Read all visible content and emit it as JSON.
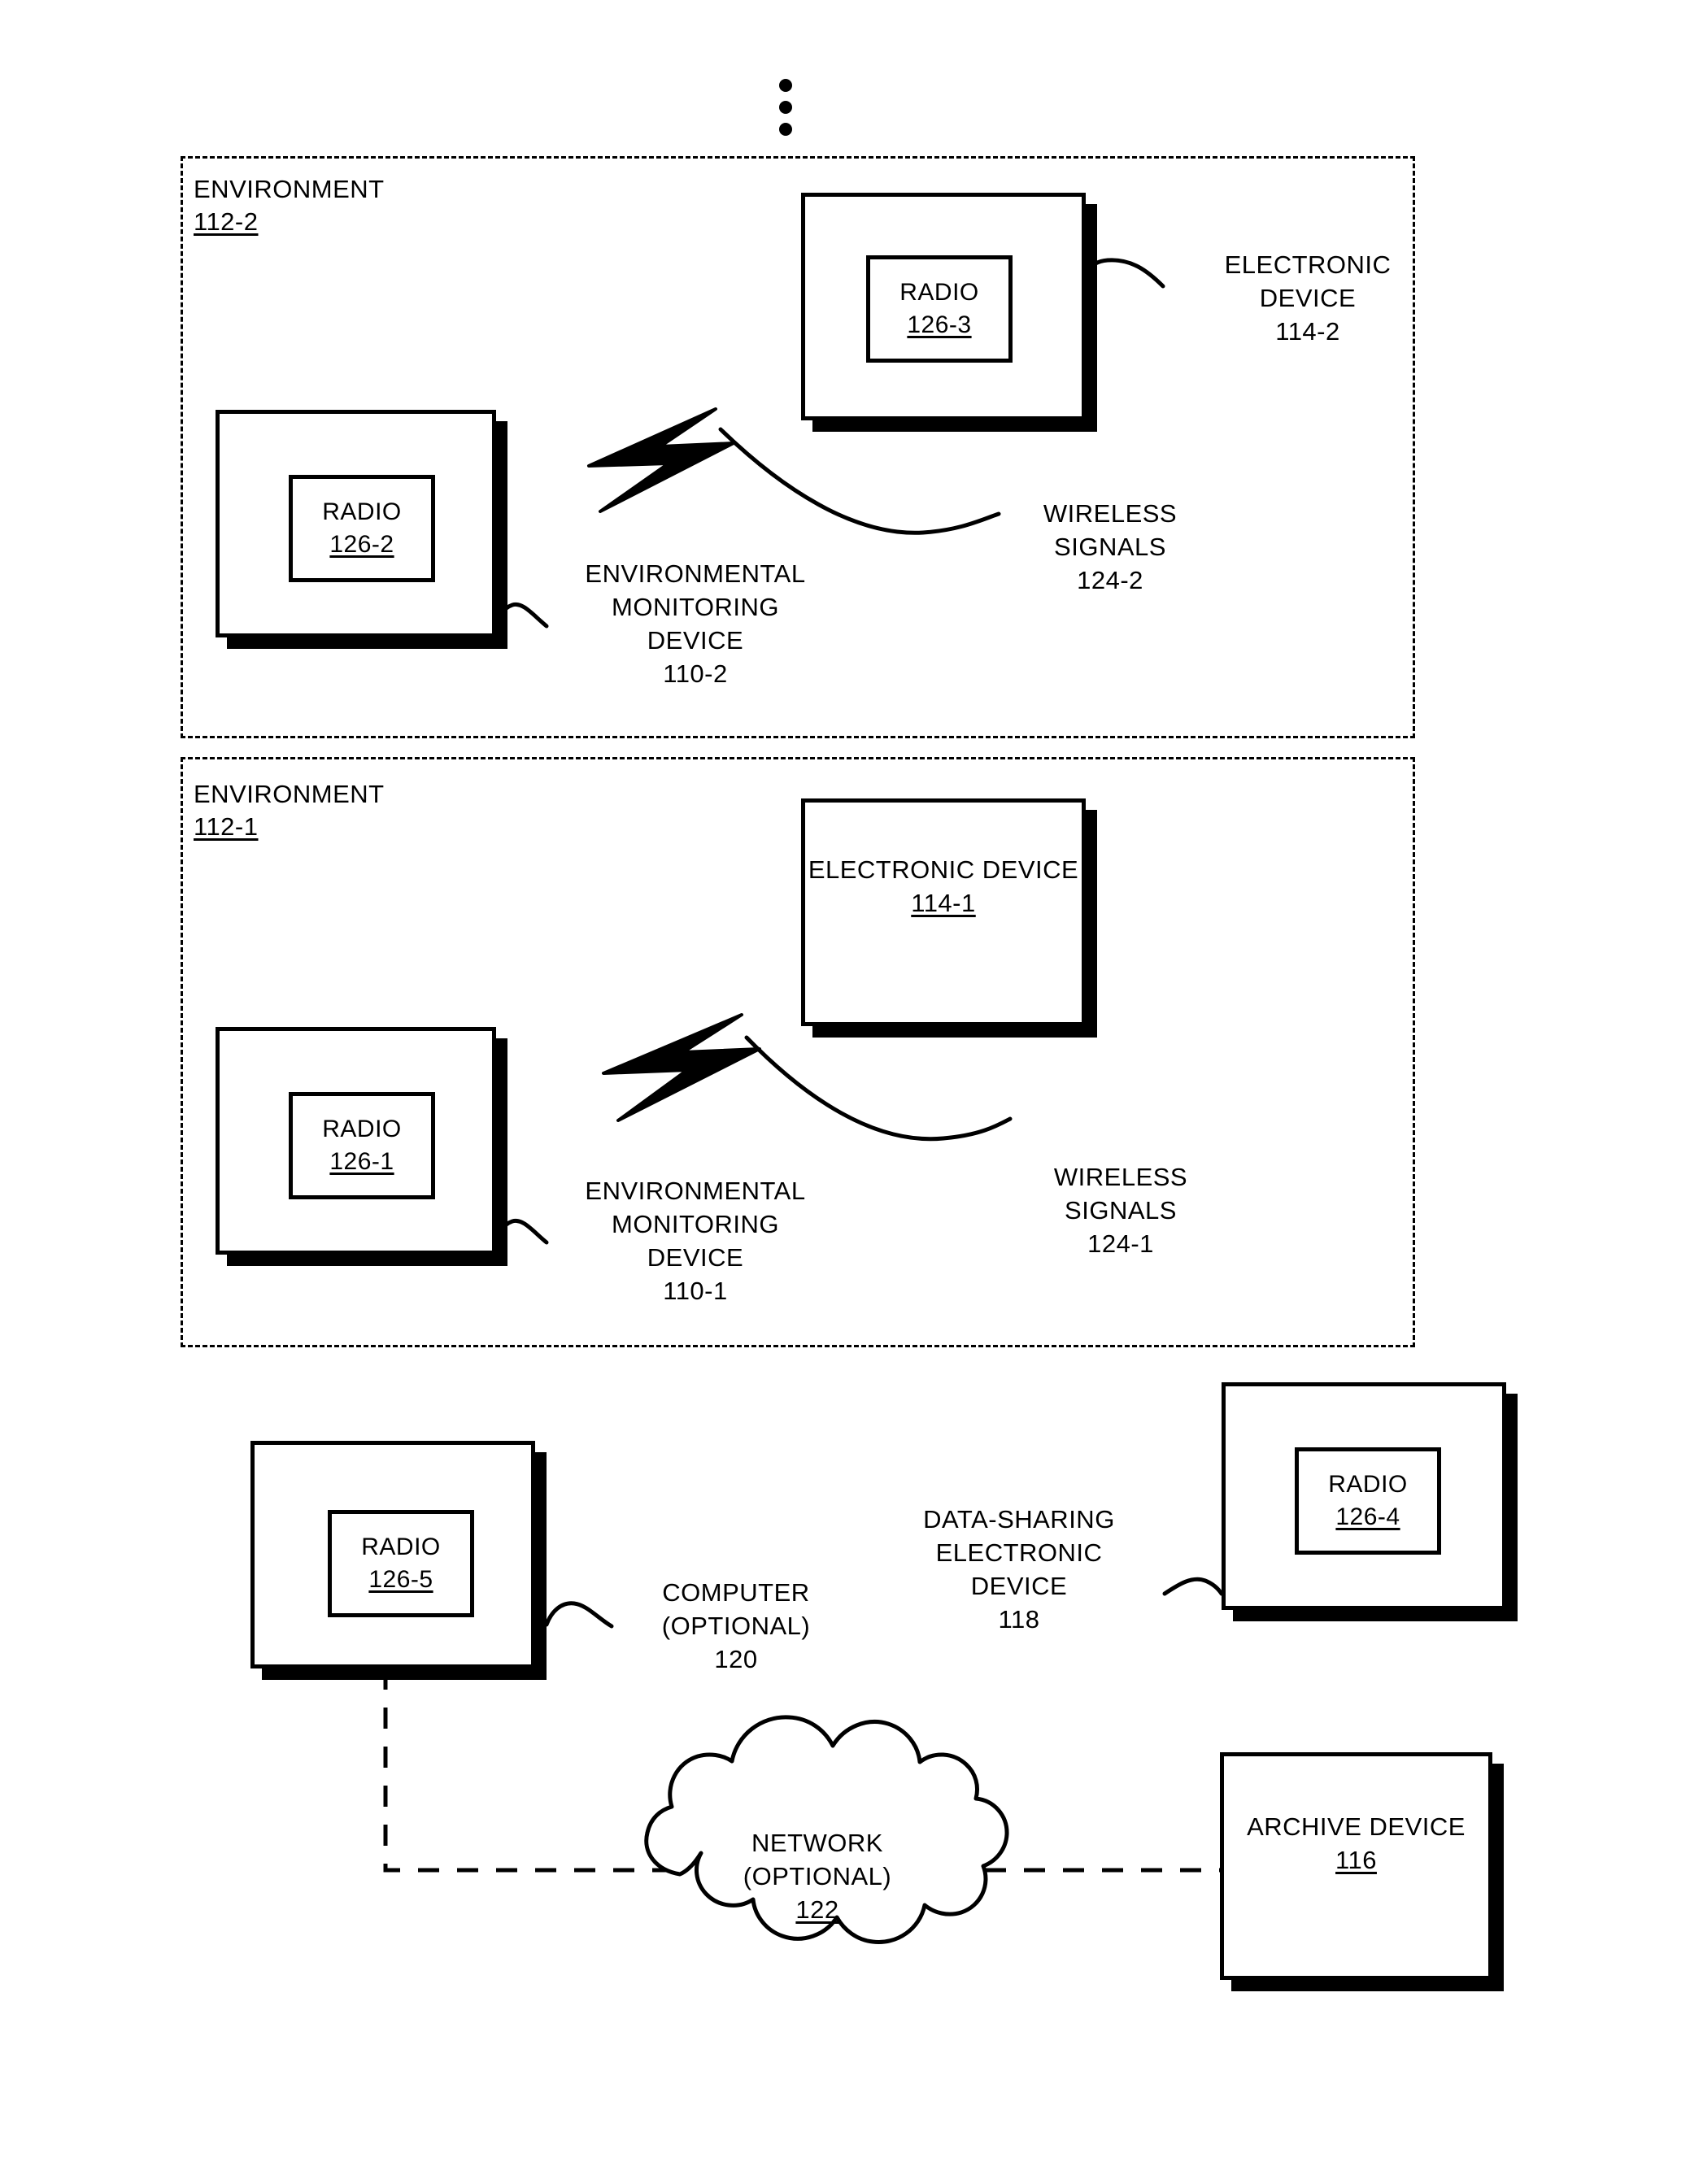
{
  "figure": {
    "type": "patent-block-diagram",
    "continuation_indicator": "vertical-ellipsis"
  },
  "environments": [
    {
      "label": "ENVIRONMENT",
      "number": "112-2"
    },
    {
      "label": "ENVIRONMENT",
      "number": "112-1"
    }
  ],
  "radios": {
    "r126_3": {
      "label": "RADIO",
      "number": "126-3"
    },
    "r126_2": {
      "label": "RADIO",
      "number": "126-2"
    },
    "r126_1": {
      "label": "RADIO",
      "number": "126-1"
    },
    "r126_4": {
      "label": "RADIO",
      "number": "126-4"
    },
    "r126_5": {
      "label": "RADIO",
      "number": "126-5"
    }
  },
  "devices": {
    "electronic_device_114_2": {
      "line1": "ELECTRONIC",
      "line2": "DEVICE",
      "number": "114-2"
    },
    "electronic_device_114_1": {
      "line1": "ELECTRONIC",
      "line2": "DEVICE",
      "number": "114-1"
    },
    "environmental_monitoring_device_110_2": {
      "line1": "ENVIRONMENTAL",
      "line2": "MONITORING",
      "line3": "DEVICE",
      "number": "110-2"
    },
    "environmental_monitoring_device_110_1": {
      "line1": "ENVIRONMENTAL",
      "line2": "MONITORING",
      "line3": "DEVICE",
      "number": "110-1"
    },
    "data_sharing_electronic_device_118": {
      "line1": "DATA-SHARING",
      "line2": "ELECTRONIC",
      "line3": "DEVICE",
      "number": "118"
    },
    "computer_120": {
      "line1": "COMPUTER",
      "line2": "(OPTIONAL)",
      "number": "120"
    },
    "archive_device_116": {
      "line1": "ARCHIVE",
      "line2": "DEVICE",
      "number": "116"
    },
    "network_122": {
      "line1": "NETWORK",
      "line2": "(OPTIONAL)",
      "number": "122"
    }
  },
  "signals": {
    "wireless_signals_124_2": {
      "line1": "WIRELESS",
      "line2": "SIGNALS",
      "number": "124-2"
    },
    "wireless_signals_124_1": {
      "line1": "WIRELESS",
      "line2": "SIGNALS",
      "number": "124-1"
    }
  },
  "colors": {
    "ink": "#000000",
    "paper": "#ffffff"
  }
}
